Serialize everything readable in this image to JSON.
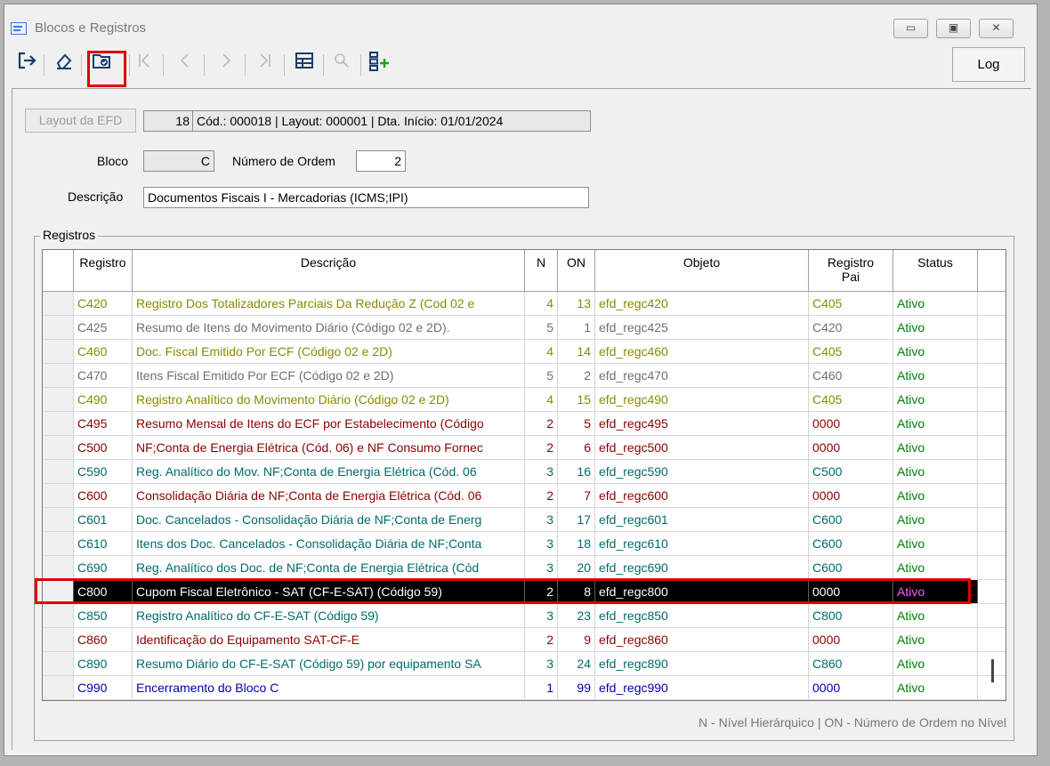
{
  "window": {
    "title": "Blocos e Registros",
    "btn_min": "▭",
    "btn_max": "▣",
    "btn_close": "✕"
  },
  "toolbar": {
    "log_label": "Log"
  },
  "form": {
    "layout_button": "Layout da EFD",
    "layout_id": "18",
    "layout_info": "Cód.: 000018 | Layout: 000001 | Dta. Início: 01/01/2024",
    "bloco_label": "Bloco",
    "bloco_value": "C",
    "ordem_label": "Número de Ordem",
    "ordem_value": "2",
    "descricao_label": "Descrição",
    "descricao_value": "Documentos Fiscais I - Mercadorias (ICMS;IPI)"
  },
  "registros": {
    "group_label": "Registros",
    "columns": {
      "registro": "Registro",
      "descricao": "Descrição",
      "n": "N",
      "on": "ON",
      "objeto": "Objeto",
      "pai_1": "Registro",
      "pai_2": "Pai",
      "status": "Status"
    },
    "rows": [
      {
        "registro": "C420",
        "descricao": "Registro Dos Totalizadores Parciais Da Redução  Z (Cod 02 e",
        "n": "4",
        "on": "13",
        "objeto": "efd_regc420",
        "pai": "C405",
        "status": "Ativo",
        "color": "#8a8a00"
      },
      {
        "registro": "C425",
        "descricao": "Resumo de Itens do Movimento Diário (Código 02 e 2D).",
        "n": "5",
        "on": "1",
        "objeto": "efd_regc425",
        "pai": "C420",
        "status": "Ativo",
        "color": "#6f6f6f"
      },
      {
        "registro": "C460",
        "descricao": "Doc. Fiscal Emitido Por ECF (Código 02 e 2D)",
        "n": "4",
        "on": "14",
        "objeto": "efd_regc460",
        "pai": "C405",
        "status": "Ativo",
        "color": "#8a8a00"
      },
      {
        "registro": "C470",
        "descricao": "Itens Fiscal Emitido Por ECF (Código 02 e 2D)",
        "n": "5",
        "on": "2",
        "objeto": "efd_regc470",
        "pai": "C460",
        "status": "Ativo",
        "color": "#6f6f6f"
      },
      {
        "registro": "C490",
        "descricao": "Registro Analítico do Movimento Diário (Código 02 e 2D)",
        "n": "4",
        "on": "15",
        "objeto": "efd_regc490",
        "pai": "C405",
        "status": "Ativo",
        "color": "#8a8a00"
      },
      {
        "registro": "C495",
        "descricao": "Resumo Mensal de Itens do ECF por Estabelecimento (Código",
        "n": "2",
        "on": "5",
        "objeto": "efd_regc495",
        "pai": "0000",
        "status": "Ativo",
        "color": "#8b0000"
      },
      {
        "registro": "C500",
        "descricao": "NF;Conta de Energia Elétrica (Cód. 06) e NF Consumo Fornec",
        "n": "2",
        "on": "6",
        "objeto": "efd_regc500",
        "pai": "0000",
        "status": "Ativo",
        "color": "#8b0000"
      },
      {
        "registro": "C590",
        "descricao": "Reg. Analítico do Mov. NF;Conta de Energia Elétrica (Cód. 06",
        "n": "3",
        "on": "16",
        "objeto": "efd_regc590",
        "pai": "C500",
        "status": "Ativo",
        "color": "#006b6b"
      },
      {
        "registro": "C600",
        "descricao": "Consolidação Diária de NF;Conta de Energia Elétrica (Cód. 06",
        "n": "2",
        "on": "7",
        "objeto": "efd_regc600",
        "pai": "0000",
        "status": "Ativo",
        "color": "#8b0000"
      },
      {
        "registro": "C601",
        "descricao": "Doc. Cancelados - Consolidação Diária de NF;Conta de Energ",
        "n": "3",
        "on": "17",
        "objeto": "efd_regc601",
        "pai": "C600",
        "status": "Ativo",
        "color": "#006b6b"
      },
      {
        "registro": "C610",
        "descricao": "Itens dos Doc. Cancelados - Consolidação Diária de NF;Conta",
        "n": "3",
        "on": "18",
        "objeto": "efd_regc610",
        "pai": "C600",
        "status": "Ativo",
        "color": "#006b6b"
      },
      {
        "registro": "C690",
        "descricao": "Reg. Analítico dos Doc. de NF;Conta de Energia Elétrica (Cód",
        "n": "3",
        "on": "20",
        "objeto": "efd_regc690",
        "pai": "C600",
        "status": "Ativo",
        "color": "#006b6b"
      },
      {
        "registro": "C800",
        "descricao": "Cupom Fiscal Eletrônico - SAT (CF-E-SAT) (Código 59)",
        "n": "2",
        "on": "8",
        "objeto": "efd_regc800",
        "pai": "0000",
        "status": "Ativo",
        "color": "#ffffff",
        "selected": true
      },
      {
        "registro": "C850",
        "descricao": "Registro Analítico do CF-E-SAT (Código 59)",
        "n": "3",
        "on": "23",
        "objeto": "efd_regc850",
        "pai": "C800",
        "status": "Ativo",
        "color": "#006b6b"
      },
      {
        "registro": "C860",
        "descricao": "Identificação do Equipamento SAT-CF-E",
        "n": "2",
        "on": "9",
        "objeto": "efd_regc860",
        "pai": "0000",
        "status": "Ativo",
        "color": "#8b0000"
      },
      {
        "registro": "C890",
        "descricao": "Resumo Diário do CF-E-SAT (Código 59) por equipamento SA",
        "n": "3",
        "on": "24",
        "objeto": "efd_regc890",
        "pai": "C860",
        "status": "Ativo",
        "color": "#006b6b"
      },
      {
        "registro": "C990",
        "descricao": "Encerramento do Bloco C",
        "n": "1",
        "on": "99",
        "objeto": "efd_regc990",
        "pai": "0000",
        "status": "Ativo",
        "color": "#0000b0"
      }
    ],
    "footnote": "N - Nível Hierárquico  |  ON - Número de Ordem no Nível"
  },
  "colors": {
    "status_active": "#008000",
    "status_selected": "#ff55ff",
    "highlight": "#e00000"
  }
}
